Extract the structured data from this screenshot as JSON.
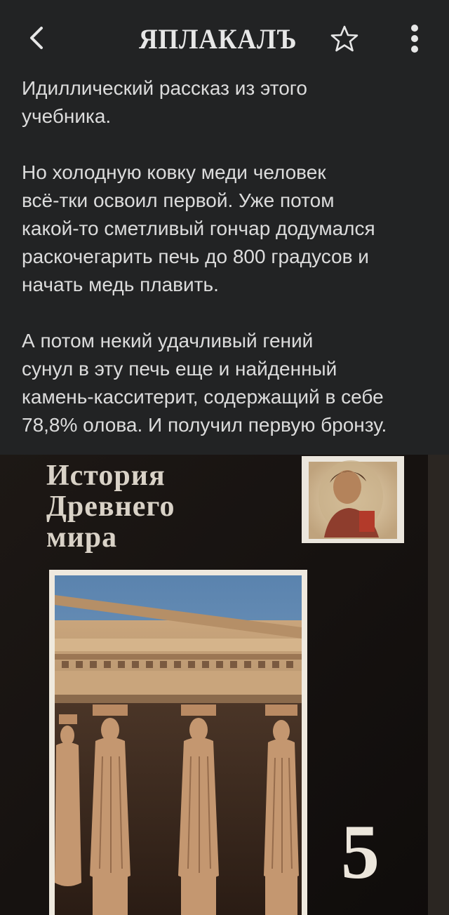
{
  "header": {
    "logo_text": "ЯПЛАКАЛЪ",
    "back_icon": "chevron-left-icon",
    "favorite_icon": "star-outline-icon",
    "menu_icon": "more-vertical-icon"
  },
  "post": {
    "paragraphs": [
      "Идиллический рассказ из этого\nучебника.",
      "Но холодную ковку меди человек\nвсё-тки освоил первой. Уже потом\nкакой-то сметливый гончар додумался\nраскочегарить печь до 800 градусов и\nначать медь плавить.",
      "А потом некий удачливый гений\nсунул в эту печь еще и найденный\nкамень-касситерит, содержащий в себе\n78,8% олова. И получил первую бронзу."
    ]
  },
  "image": {
    "book_title_lines": [
      "История",
      "Древнего",
      "мира"
    ],
    "grade": "5"
  },
  "colors": {
    "background": "#222324",
    "text": "#dcdcdc",
    "icon": "#e7e7e7"
  }
}
